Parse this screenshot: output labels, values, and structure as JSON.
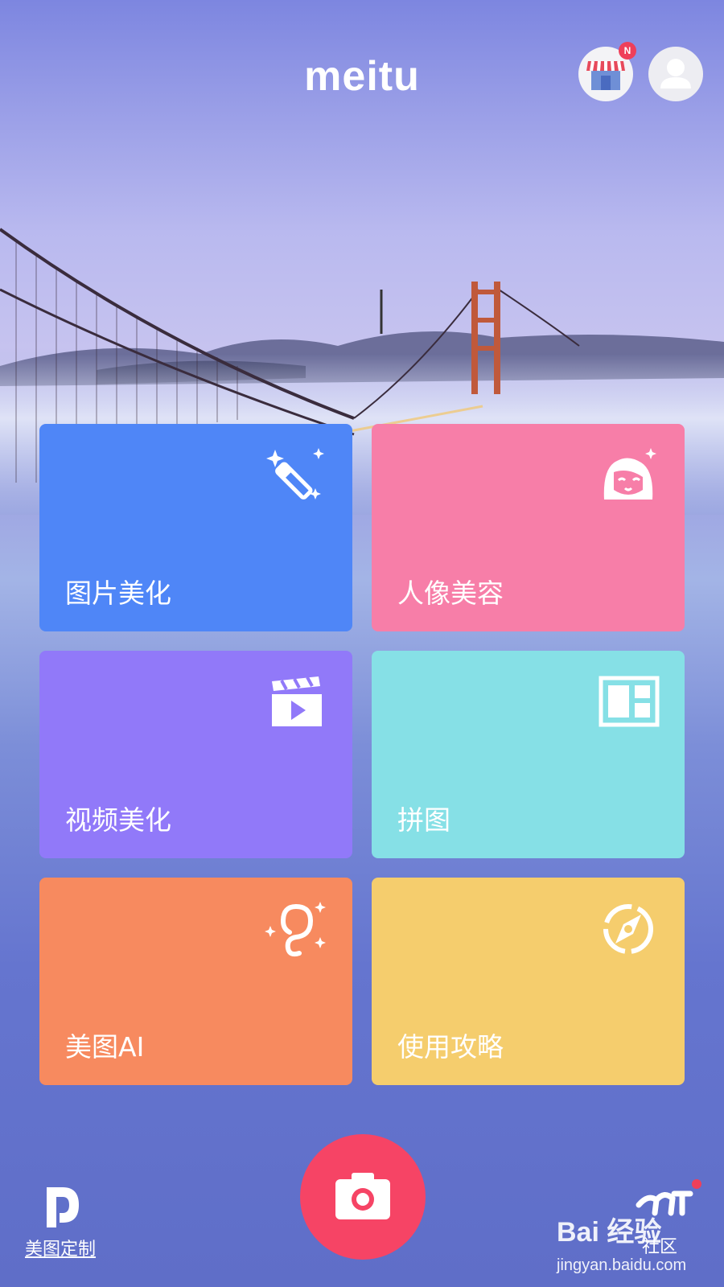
{
  "app": {
    "logo_text": "meitu"
  },
  "header": {
    "store_icon": "store-icon",
    "store_badge": "N",
    "profile_icon": "user-icon",
    "badge_color": "#ef3f5a"
  },
  "tiles": [
    {
      "label": "图片美化",
      "icon": "magic-wand-icon",
      "color": "#4f86f7"
    },
    {
      "label": "人像美容",
      "icon": "face-sparkle-icon",
      "color": "#f77ea8"
    },
    {
      "label": "视频美化",
      "icon": "clapperboard-icon",
      "color": "#9179f9"
    },
    {
      "label": "拼图",
      "icon": "collage-icon",
      "color": "#86e0e6"
    },
    {
      "label": "美图AI",
      "icon": "ai-sparkle-icon",
      "color": "#f78a5f"
    },
    {
      "label": "使用攻略",
      "icon": "compass-icon",
      "color": "#f5cd6d"
    }
  ],
  "bottom": {
    "camera_icon": "camera-icon",
    "camera_color": "#f64465",
    "left_label": "美图定制",
    "left_icon": "custom-d-icon",
    "right_label": "社区",
    "right_icon": "community-icon"
  },
  "watermark": {
    "brand": "Bai 经验",
    "url": "jingyan.baidu.com"
  }
}
